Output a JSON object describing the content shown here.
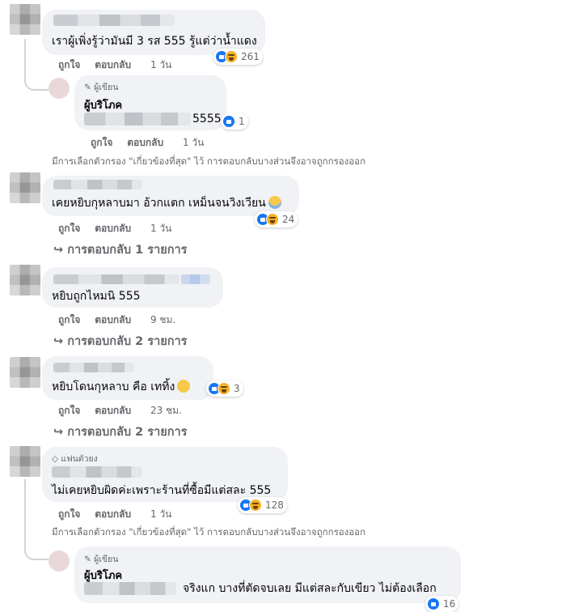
{
  "comments": [
    {
      "text": "เราผู้เพิ่งรู้ว่ามันมี 3 รส 555 รู้แต่ว่าน้ำแดง",
      "reaction_count": "261",
      "like_label": "ถูกใจ",
      "reply_label": "ตอบกลับ",
      "time": "1 วัน"
    },
    {
      "author_tag": "ผู้เขียน",
      "author_name": "ผู้บริโภค",
      "text": "5555",
      "reaction_count": "1",
      "like_label": "ถูกใจ",
      "reply_label": "ตอบกลับ",
      "time": "1 วัน"
    },
    {
      "text": "เคยหยิบกุหลาบมา อ้วกแตก เหม็นจนวิงเวียน",
      "reaction_count": "24",
      "like_label": "ถูกใจ",
      "reply_label": "ตอบกลับ",
      "time": "1 วัน",
      "replies_link": "การตอบกลับ 1 รายการ"
    },
    {
      "text": "หยิบถูกไหมนิ 555",
      "like_label": "ถูกใจ",
      "reply_label": "ตอบกลับ",
      "time": "9 ชม.",
      "replies_link": "การตอบกลับ 2 รายการ"
    },
    {
      "text": "หยิบโดนกุหลาบ คือ เททิ้ง",
      "reaction_count": "3",
      "like_label": "ถูกใจ",
      "reply_label": "ตอบกลับ",
      "time": "23 ชม.",
      "replies_link": "การตอบกลับ 2 รายการ"
    },
    {
      "author_tag": "แฟนตัวยง",
      "text": "ไม่เคยหยิบผิดค่ะเพราะร้านที่ซื้อมีแต่สละ 555",
      "reaction_count": "128",
      "like_label": "ถูกใจ",
      "reply_label": "ตอบกลับ",
      "time": "1 วัน"
    },
    {
      "author_tag": "ผู้เขียน",
      "author_name": "ผู้บริโภค",
      "text": "จริงแก บางที่ตัดจบเลย มีแต่สละกับเขียว ไม่ต้องเลือก",
      "reaction_count": "16"
    }
  ],
  "filter_note": "มีการเลือกตัวกรอง \"เกี่ยวข้องที่สุด\" ไว้ การตอบกลับบางส่วนจึงอาจถูกกรองออก",
  "colors": {
    "bubble": "#f0f2f5",
    "meta_text": "#65676b",
    "like_blue": "#1877f2",
    "haha_yellow": "#f7b125"
  },
  "icons": [
    "like-reaction-icon",
    "haha-reaction-icon",
    "pencil-icon",
    "diamond-icon",
    "reply-arrow-icon",
    "sad-emoji-icon",
    "crying-emoji-icon"
  ]
}
